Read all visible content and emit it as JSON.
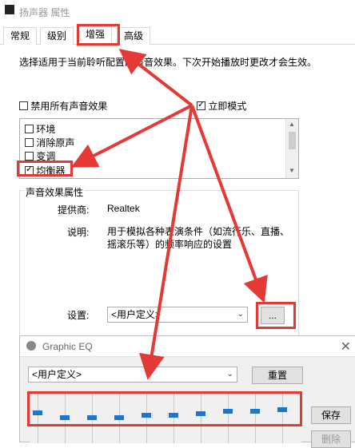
{
  "window": {
    "title": "扬声器 属性"
  },
  "tabs": [
    {
      "label": "常规",
      "active": false
    },
    {
      "label": "级别",
      "active": false
    },
    {
      "label": "增强",
      "active": true
    },
    {
      "label": "高级",
      "active": false
    }
  ],
  "enhancements": {
    "description": "选择适用于当前聆听配置的声音效果。下次开始播放时更改才会生效。",
    "disable_all_label": "禁用所有声音效果",
    "disable_all_checked": false,
    "immediate_mode_label": "立即模式",
    "immediate_mode_checked": true,
    "effects": [
      {
        "label": "环境",
        "checked": false
      },
      {
        "label": "消除原声",
        "checked": false
      },
      {
        "label": "变调",
        "checked": false
      },
      {
        "label": "均衡器",
        "checked": true
      }
    ]
  },
  "properties": {
    "group_title": "声音效果属性",
    "provider_label": "提供商:",
    "provider_value": "Realtek",
    "description_label": "说明:",
    "description_value": "用于模拟各种表演条件（如流行乐、直播、摇滚乐等）的频率响应的设置",
    "setting_label": "设置:",
    "setting_value": "<用户定义>",
    "more_button": "..."
  },
  "eq": {
    "title": "Graphic EQ",
    "preset_value": "<用户定义>",
    "reset_button": "重置",
    "save_button": "保存",
    "delete_button": "删除",
    "bands": 10,
    "levels": [
      0.4,
      0.5,
      0.5,
      0.5,
      0.45,
      0.45,
      0.42,
      0.38,
      0.38,
      0.34
    ]
  },
  "colors": {
    "annotation_red": "#e53935",
    "slider_thumb": "#1976d2"
  }
}
